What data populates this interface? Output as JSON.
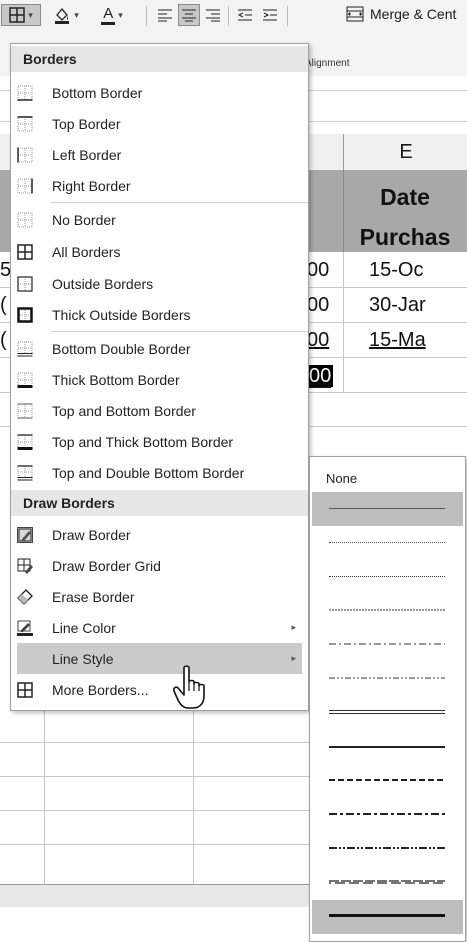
{
  "ribbon": {
    "borders_icon": "borders-grid-icon",
    "fill_icon": "fill-color-icon",
    "font_color_letter": "A",
    "caret": "▾",
    "group_label": "Alignment",
    "merge_label": "Merge & Cent"
  },
  "sheet": {
    "column_header": "E",
    "header_line1": "Date",
    "header_line2": "Purchas",
    "left_fragments": [
      "5",
      "(",
      "("
    ],
    "rows": [
      {
        "d": "00",
        "e": "15-Oc"
      },
      {
        "d": "00",
        "e": "30-Jar"
      },
      {
        "d": "00",
        "e": "15-Ma"
      }
    ],
    "selected_cell": "00"
  },
  "menu": {
    "section_borders": "Borders",
    "section_draw": "Draw Borders",
    "items": [
      {
        "label": "Bottom Border",
        "icon": "bottom-border-icon"
      },
      {
        "label": "Top Border",
        "icon": "top-border-icon"
      },
      {
        "label": "Left Border",
        "icon": "left-border-icon"
      },
      {
        "label": "Right Border",
        "icon": "right-border-icon"
      },
      {
        "label": "No Border",
        "icon": "no-border-icon"
      },
      {
        "label": "All Borders",
        "icon": "all-borders-icon"
      },
      {
        "label": "Outside Borders",
        "icon": "outside-borders-icon"
      },
      {
        "label": "Thick Outside Borders",
        "icon": "thick-outside-borders-icon"
      },
      {
        "label": "Bottom Double Border",
        "icon": "bottom-double-border-icon"
      },
      {
        "label": "Thick Bottom Border",
        "icon": "thick-bottom-border-icon"
      },
      {
        "label": "Top and Bottom Border",
        "icon": "top-and-bottom-border-icon"
      },
      {
        "label": "Top and Thick Bottom Border",
        "icon": "top-and-thick-bottom-border-icon"
      },
      {
        "label": "Top and Double Bottom Border",
        "icon": "top-and-double-bottom-border-icon"
      }
    ],
    "draw_items": [
      {
        "label": "Draw Border",
        "icon": "draw-border-icon"
      },
      {
        "label": "Draw Border Grid",
        "icon": "draw-border-grid-icon"
      },
      {
        "label": "Erase Border",
        "icon": "eraser-icon"
      },
      {
        "label": "Line Color",
        "icon": "line-color-icon",
        "submenu": true
      },
      {
        "label": "Line Style",
        "icon": "",
        "submenu": true,
        "highlighted": true
      },
      {
        "label": "More Borders...",
        "icon": "more-borders-icon"
      }
    ],
    "submenu_arrow": "▸"
  },
  "line_style": {
    "none_label": "None",
    "styles": [
      "hair",
      "dotted",
      "dashdotdot-thin",
      "dashed-thin",
      "dashdot-thin",
      "dashdotdot-thin2",
      "double",
      "medium",
      "medium-dashed",
      "medium-dashdot",
      "medium-dashdotdot",
      "slanted-dashdot",
      "thick"
    ],
    "selected": "hair"
  },
  "colors": {
    "ribbon_bg": "#f3f3f3",
    "header_fill": "#a8a8a8",
    "menu_highlight": "#cbcbcb",
    "section_header": "#e6e6e6"
  }
}
